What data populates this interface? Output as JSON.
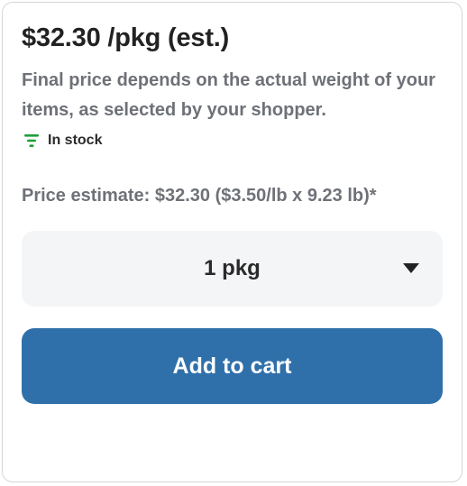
{
  "product": {
    "price_title": "$32.30 /pkg (est.)",
    "price_note": "Final price depends on the actual weight of your items, as selected by your shopper.",
    "stock_status": "In stock",
    "stock_icon": "stock-bars-icon",
    "stock_color": "#1f9e3a",
    "price_estimate": "Price estimate: $32.30 ($3.50/lb x 9.23 lb)*"
  },
  "quantity": {
    "selected": "1 pkg",
    "icon": "caret-down-icon"
  },
  "cart": {
    "add_label": "Add to cart",
    "button_color": "#2f70ab"
  }
}
